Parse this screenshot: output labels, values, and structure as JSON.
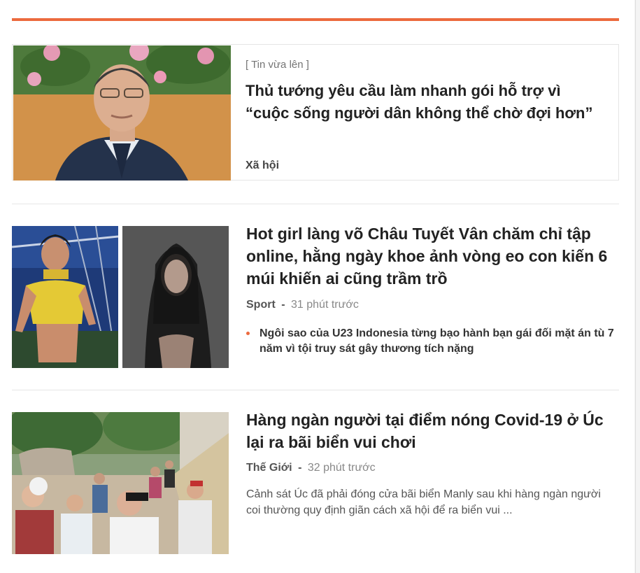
{
  "featured": {
    "kicker": "[ Tin vừa lên ]",
    "title": "Thủ tướng yêu cầu làm nhanh gói hỗ trợ vì “cuộc sống người dân không thể chờ đợi hơn”",
    "category": "Xã hội"
  },
  "articles": [
    {
      "title": "Hot girl làng võ Châu Tuyết Vân chăm chỉ tập online, hằng ngày khoe ảnh vòng eo con kiến 6 múi khiến ai cũng trầm trồ",
      "category": "Sport",
      "separator": "-",
      "time": "31 phút trước",
      "related": "Ngôi sao của U23 Indonesia từng bạo hành bạn gái đối mặt án tù 7 năm vì tội truy sát gây thương tích nặng"
    },
    {
      "title": "Hàng ngàn người tại điểm nóng Covid-19 ở Úc lại ra bãi biển vui chơi",
      "category": "Thế Giới",
      "separator": "-",
      "time": "32 phút trước",
      "summary": "Cảnh sát Úc đã phải đóng cửa bãi biển Manly sau khi hàng ngàn người coi thường quy định giãn cách xã hội để ra biển vui ..."
    }
  ],
  "colors": {
    "accent": "#ec6a3e",
    "divider": "#e6e6e6"
  }
}
